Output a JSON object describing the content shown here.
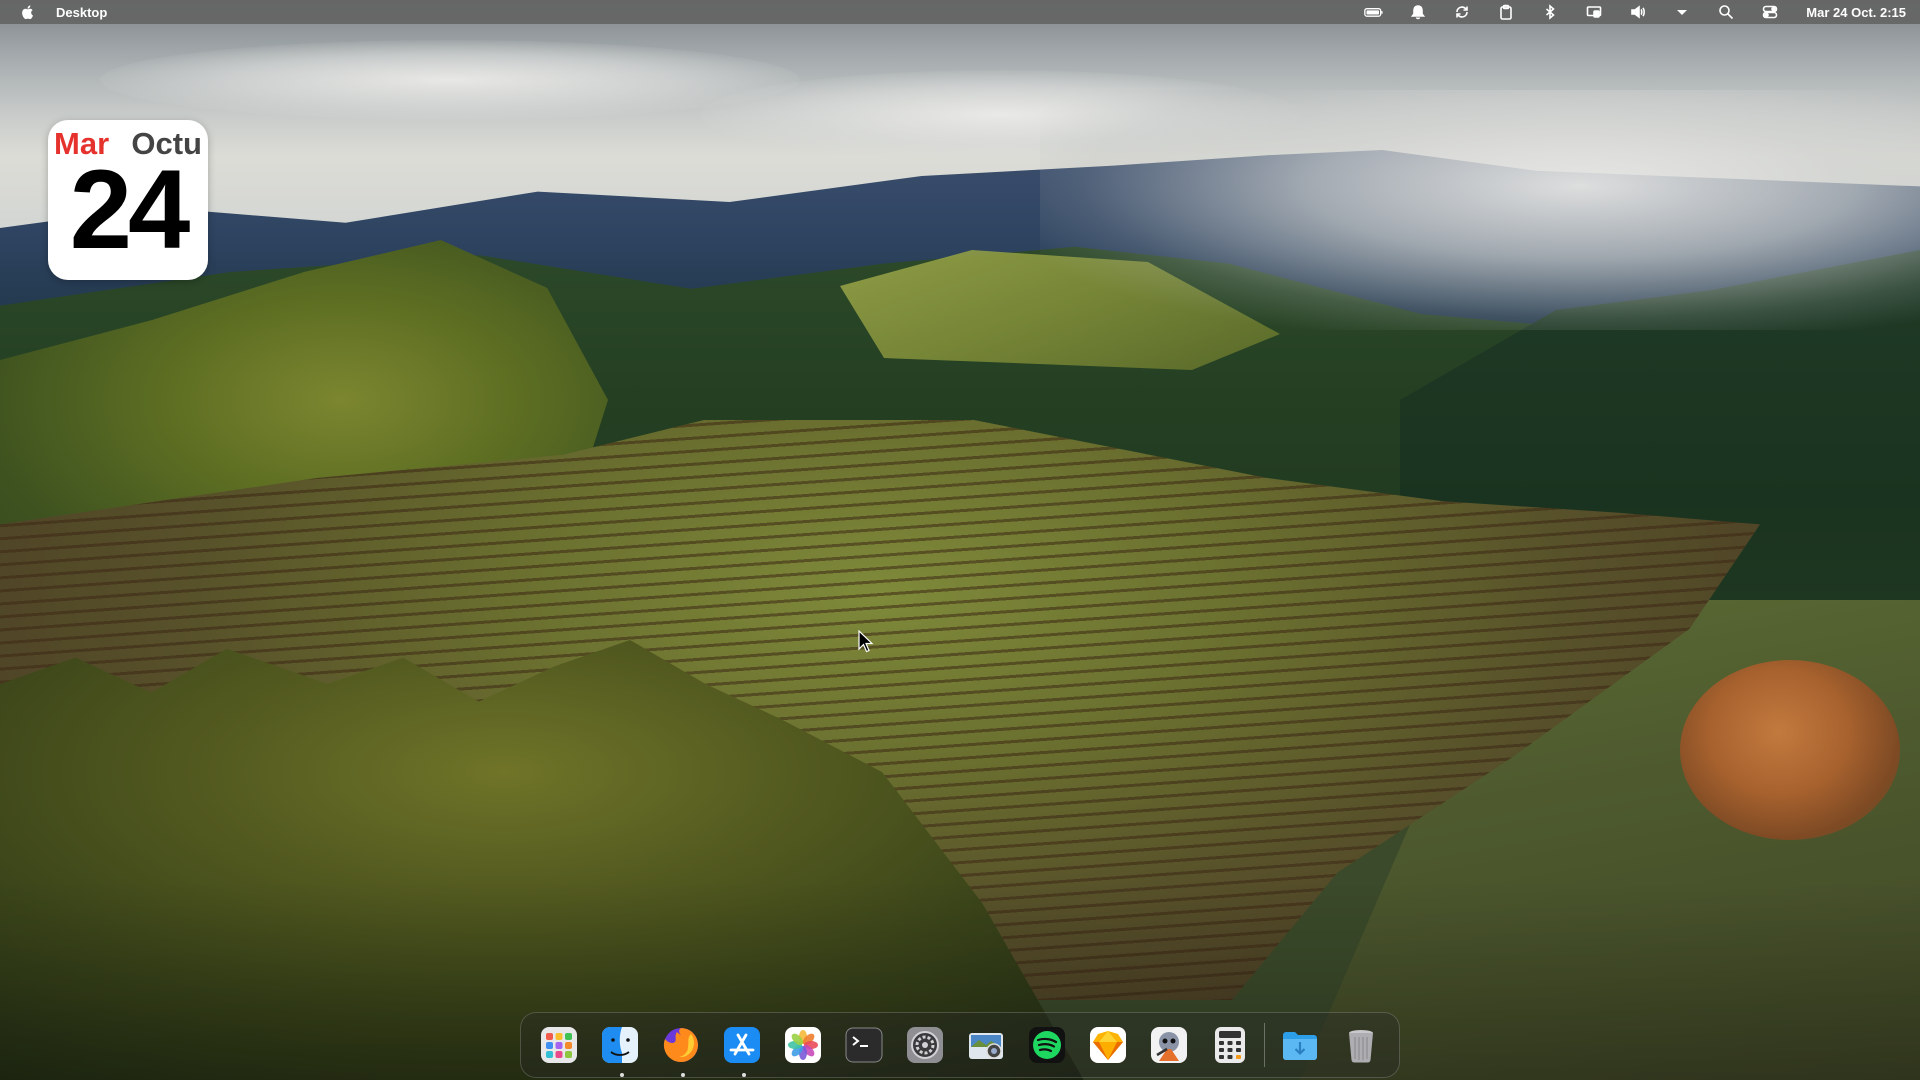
{
  "menubar": {
    "app_name": "Desktop",
    "clock": "Mar 24 Oct. 2:15",
    "icons": [
      "apple-icon",
      "battery-icon",
      "notification-bell-icon",
      "sync-icon",
      "clipboard-icon",
      "bluetooth-icon",
      "screen-mirroring-icon",
      "volume-icon",
      "dropdown-arrow-icon",
      "search-icon",
      "control-center-icon"
    ]
  },
  "calendar_widget": {
    "weekday": "Mar",
    "month": "Octu",
    "day": "24",
    "accent_color": "#e5322d"
  },
  "dock": {
    "apps": [
      {
        "name": "Launchpad",
        "icon": "launchpad-icon",
        "running": false
      },
      {
        "name": "Finder",
        "icon": "finder-icon",
        "running": true
      },
      {
        "name": "Firefox",
        "icon": "firefox-icon",
        "running": true
      },
      {
        "name": "App Store",
        "icon": "app-store-icon",
        "running": true
      },
      {
        "name": "Photos",
        "icon": "photos-icon",
        "running": false
      },
      {
        "name": "Terminal",
        "icon": "terminal-icon",
        "running": false
      },
      {
        "name": "System Preferences",
        "icon": "system-preferences-icon",
        "running": false
      },
      {
        "name": "Image Capture",
        "icon": "image-capture-icon",
        "running": false
      },
      {
        "name": "Spotify",
        "icon": "spotify-icon",
        "running": false
      },
      {
        "name": "Sketch",
        "icon": "sketch-icon",
        "running": false
      },
      {
        "name": "Automator",
        "icon": "automator-icon",
        "running": false
      },
      {
        "name": "Calculator",
        "icon": "calculator-icon",
        "running": false
      },
      {
        "name": "Downloads",
        "icon": "downloads-folder-icon",
        "running": false
      },
      {
        "name": "Trash",
        "icon": "trash-icon",
        "running": false
      }
    ]
  }
}
